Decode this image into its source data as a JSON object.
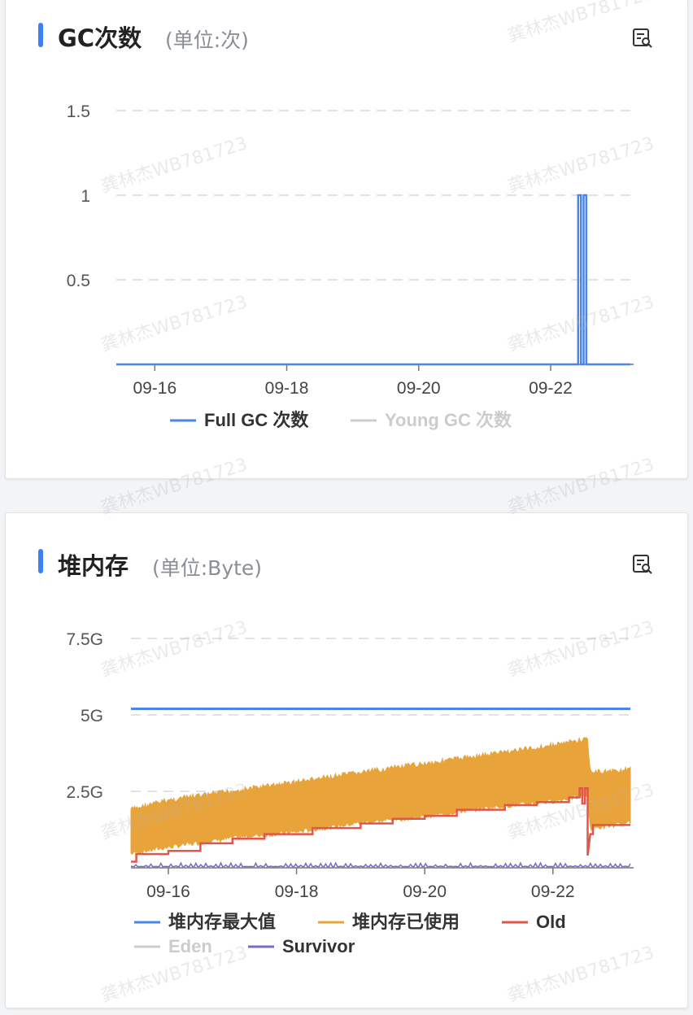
{
  "watermark": "龚林杰WB781723",
  "gc_card": {
    "title": "GC次数",
    "unit": "(单位:次)",
    "icon": "table-view-icon"
  },
  "heap_card": {
    "title": "堆内存",
    "unit": "(单位:Byte)",
    "icon": "table-view-icon"
  },
  "colors": {
    "accent": "#3d7ff5",
    "full_gc": "#4a86e8",
    "young_gc": "#cccccc",
    "heap_max": "#4a86e8",
    "heap_used": "#e8a43a",
    "old": "#e0564a",
    "eden": "#cccccc",
    "survivor": "#7b68c8"
  },
  "chart_data": [
    {
      "type": "line",
      "x_tick_labels": [
        "09-16",
        "09-18",
        "09-20",
        "09-22"
      ],
      "x_tick_dates": [
        "09-16",
        "09-18",
        "09-20",
        "09-22"
      ],
      "xlim": [
        "09-15 10:00",
        "09-23 05:00"
      ],
      "y_tick_labels": [
        "1.5",
        "1",
        "0.5"
      ],
      "y_tick_values": [
        1.5,
        1,
        0.5
      ],
      "ylim": [
        0,
        1.5
      ],
      "grid": true,
      "legend_position": "bottom",
      "series": [
        {
          "name": "Full GC 次数",
          "active": true,
          "points": [
            [
              "09-15 10:00",
              0
            ],
            [
              "09-22 10:00",
              0
            ],
            [
              "09-22 10:00",
              1
            ],
            [
              "09-22 11:00",
              1
            ],
            [
              "09-22 11:00",
              0
            ],
            [
              "09-22 12:00",
              0
            ],
            [
              "09-22 12:00",
              1
            ],
            [
              "09-22 13:00",
              1
            ],
            [
              "09-22 13:00",
              0
            ],
            [
              "09-23 05:00",
              0
            ]
          ]
        },
        {
          "name": "Young GC 次数",
          "active": false,
          "points": []
        }
      ]
    },
    {
      "type": "area",
      "x_tick_labels": [
        "09-16",
        "09-18",
        "09-20",
        "09-22"
      ],
      "x_tick_dates": [
        "09-16",
        "09-18",
        "09-20",
        "09-22"
      ],
      "xlim": [
        "09-15 10:00",
        "09-23 05:00"
      ],
      "y_tick_labels": [
        "7.5G",
        "5G",
        "2.5G"
      ],
      "y_tick_values": [
        7.5,
        5,
        2.5
      ],
      "y_unit": "G",
      "ylim": [
        0,
        7.5
      ],
      "grid": true,
      "legend_position": "bottom",
      "series": [
        {
          "name": "堆内存最大值",
          "active": true,
          "points": [
            [
              "09-15 10:00",
              5.2
            ],
            [
              "09-23 05:00",
              5.2
            ]
          ]
        },
        {
          "name": "堆内存已使用",
          "active": true,
          "band_low": [
            [
              "09-15 10:00",
              0.4
            ],
            [
              "09-16 00:00",
              0.6
            ],
            [
              "09-17 00:00",
              0.9
            ],
            [
              "09-18 00:00",
              1.1
            ],
            [
              "09-19 00:00",
              1.4
            ],
            [
              "09-20 00:00",
              1.6
            ],
            [
              "09-21 00:00",
              1.9
            ],
            [
              "09-22 00:00",
              2.1
            ],
            [
              "09-22 13:00",
              2.3
            ],
            [
              "09-22 14:00",
              1.2
            ],
            [
              "09-23 05:00",
              1.4
            ]
          ],
          "band_high": [
            [
              "09-15 10:00",
              2.0
            ],
            [
              "09-16 00:00",
              2.3
            ],
            [
              "09-17 00:00",
              2.6
            ],
            [
              "09-18 00:00",
              2.9
            ],
            [
              "09-19 00:00",
              3.2
            ],
            [
              "09-20 00:00",
              3.5
            ],
            [
              "09-21 00:00",
              3.8
            ],
            [
              "09-22 00:00",
              4.1
            ],
            [
              "09-22 13:00",
              4.3
            ],
            [
              "09-22 14:00",
              3.2
            ],
            [
              "09-23 05:00",
              3.3
            ]
          ]
        },
        {
          "name": "Old",
          "active": true,
          "points": [
            [
              "09-15 10:00",
              0.2
            ],
            [
              "09-15 12:00",
              0.2
            ],
            [
              "09-15 12:00",
              0.45
            ],
            [
              "09-16 00:00",
              0.45
            ],
            [
              "09-16 00:00",
              0.55
            ],
            [
              "09-16 12:00",
              0.55
            ],
            [
              "09-16 12:00",
              0.8
            ],
            [
              "09-17 00:00",
              0.8
            ],
            [
              "09-17 00:00",
              0.95
            ],
            [
              "09-17 12:00",
              0.95
            ],
            [
              "09-17 12:00",
              1.1
            ],
            [
              "09-18 06:00",
              1.1
            ],
            [
              "09-18 06:00",
              1.3
            ],
            [
              "09-19 00:00",
              1.3
            ],
            [
              "09-19 00:00",
              1.45
            ],
            [
              "09-19 12:00",
              1.45
            ],
            [
              "09-19 12:00",
              1.6
            ],
            [
              "09-20 00:00",
              1.6
            ],
            [
              "09-20 00:00",
              1.7
            ],
            [
              "09-20 12:00",
              1.7
            ],
            [
              "09-20 12:00",
              1.9
            ],
            [
              "09-21 06:00",
              1.9
            ],
            [
              "09-21 06:00",
              2.05
            ],
            [
              "09-21 18:00",
              2.05
            ],
            [
              "09-21 18:00",
              2.15
            ],
            [
              "09-22 06:00",
              2.15
            ],
            [
              "09-22 06:00",
              2.3
            ],
            [
              "09-22 10:00",
              2.3
            ],
            [
              "09-22 10:00",
              2.6
            ],
            [
              "09-22 11:00",
              2.6
            ],
            [
              "09-22 11:00",
              2.1
            ],
            [
              "09-22 12:00",
              2.1
            ],
            [
              "09-22 12:00",
              2.6
            ],
            [
              "09-22 13:00",
              2.6
            ],
            [
              "09-22 13:00",
              0.4
            ],
            [
              "09-22 14:00",
              1.1
            ],
            [
              "09-22 15:00",
              1.1
            ],
            [
              "09-22 15:00",
              1.4
            ],
            [
              "09-23 05:00",
              1.4
            ]
          ]
        },
        {
          "name": "Eden",
          "active": false,
          "points": []
        },
        {
          "name": "Survivor",
          "active": true,
          "points": [
            [
              "09-15 10:00",
              0.05
            ],
            [
              "09-23 05:00",
              0.05
            ]
          ]
        }
      ]
    }
  ]
}
